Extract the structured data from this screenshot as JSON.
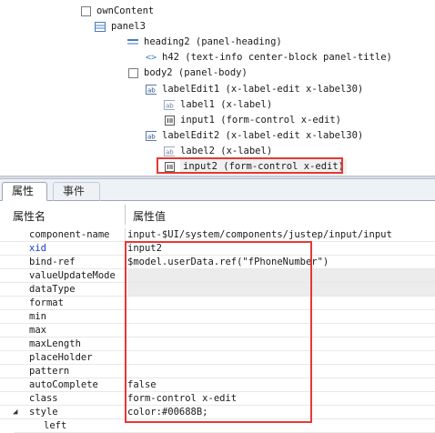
{
  "tree": {
    "nodes": [
      {
        "label": "ownContent",
        "icon": "checkbox-node-icon"
      },
      {
        "label": "panel3",
        "icon": "panel-node-icon"
      },
      {
        "label": "heading2 (panel-heading)",
        "icon": "heading-node-icon"
      },
      {
        "label": "h42 (text-info center-block panel-title)",
        "icon": "code-tag-icon"
      },
      {
        "label": "body2 (panel-body)",
        "icon": "checkbox-node-icon"
      },
      {
        "label": "labelEdit1 (x-label-edit x-label30)",
        "icon": "label-edit-icon"
      },
      {
        "label": "label1 (x-label)",
        "icon": "label-field-icon"
      },
      {
        "label": "input1 (form-control x-edit)",
        "icon": "input-field-icon"
      },
      {
        "label": "labelEdit2 (x-label-edit x-label30)",
        "icon": "label-edit-icon"
      },
      {
        "label": "label2 (x-label)",
        "icon": "label-field-icon"
      },
      {
        "label": "input2 (form-control x-edit)",
        "icon": "input-field-icon"
      }
    ]
  },
  "tabs": {
    "properties": "属性",
    "events": "事件"
  },
  "grid": {
    "header_name": "属性名",
    "header_value": "属性值",
    "rows": [
      {
        "name": "component-name",
        "value": "input-$UI/system/components/justep/input/input"
      },
      {
        "name": "xid",
        "value": "input2"
      },
      {
        "name": "bind-ref",
        "value": "$model.userData.ref(\"fPhoneNumber\")"
      },
      {
        "name": "valueUpdateMode",
        "value": ""
      },
      {
        "name": "dataType",
        "value": ""
      },
      {
        "name": "format",
        "value": ""
      },
      {
        "name": "min",
        "value": ""
      },
      {
        "name": "max",
        "value": ""
      },
      {
        "name": "maxLength",
        "value": ""
      },
      {
        "name": "placeHolder",
        "value": ""
      },
      {
        "name": "pattern",
        "value": ""
      },
      {
        "name": "autoComplete",
        "value": "false"
      },
      {
        "name": "class",
        "value": "form-control x-edit"
      },
      {
        "name": "style",
        "value": "color:#00688B;"
      },
      {
        "name": "left",
        "value": ""
      }
    ]
  },
  "colors": {
    "highlight": "#e53935",
    "blue_key": "#1a3ccc"
  }
}
